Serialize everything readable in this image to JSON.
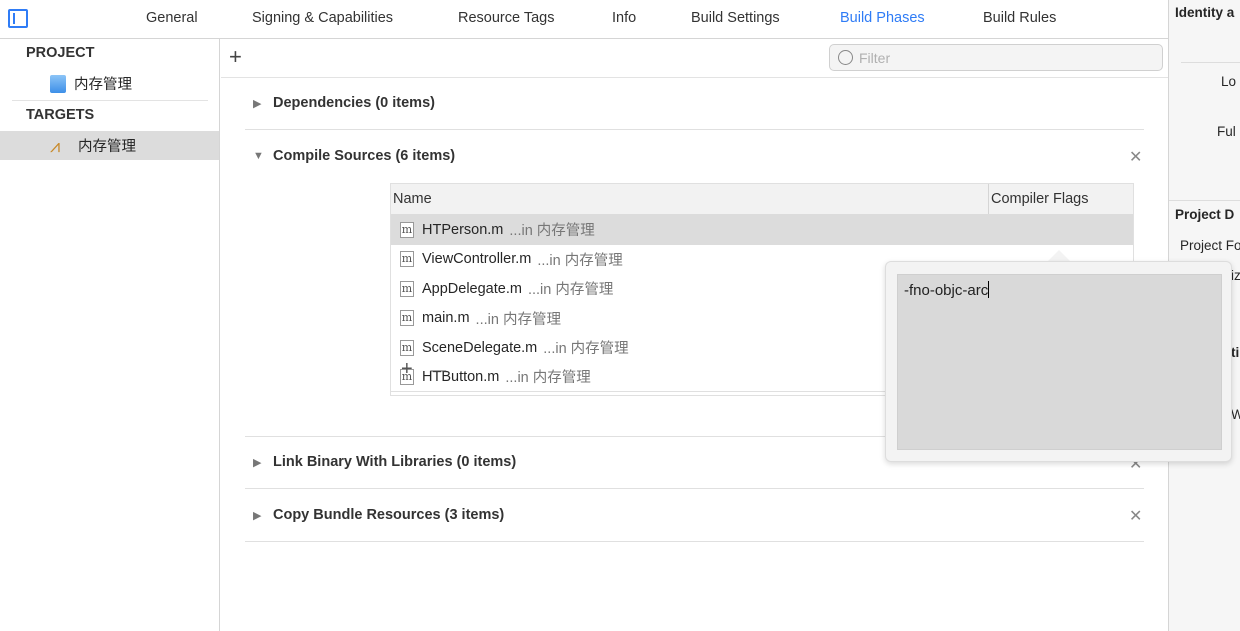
{
  "tabs": [
    {
      "label": "General",
      "active": false
    },
    {
      "label": "Signing & Capabilities",
      "active": false
    },
    {
      "label": "Resource Tags",
      "active": false
    },
    {
      "label": "Info",
      "active": false
    },
    {
      "label": "Build Settings",
      "active": false
    },
    {
      "label": "Build Phases",
      "active": true
    },
    {
      "label": "Build Rules",
      "active": false
    }
  ],
  "accent_color": "#2f7cf6",
  "sidebar": {
    "project_header": "PROJECT",
    "project_item": "内存管理",
    "targets_header": "TARGETS",
    "target_item": "内存管理"
  },
  "toolbar": {
    "add_label": "+",
    "filter_placeholder": "Filter"
  },
  "phases": {
    "dependencies": "Dependencies (0 items)",
    "compile": "Compile Sources (6 items)",
    "link": "Link Binary With Libraries (0 items)",
    "copy": "Copy Bundle Resources (3 items)"
  },
  "compile_table": {
    "col_name": "Name",
    "col_flags": "Compiler Flags",
    "rows": [
      {
        "file": "HTPerson.m",
        "location": "...in 内存管理"
      },
      {
        "file": "ViewController.m",
        "location": "...in 内存管理"
      },
      {
        "file": "AppDelegate.m",
        "location": "...in 内存管理"
      },
      {
        "file": "main.m",
        "location": "...in 内存管理"
      },
      {
        "file": "SceneDelegate.m",
        "location": "...in 内存管理"
      },
      {
        "file": "HTButton.m",
        "location": "...in 内存管理"
      }
    ],
    "add": "+",
    "remove": "—"
  },
  "flags_popover": {
    "value": "-fno-objc-arc"
  },
  "inspector": {
    "identity": "Identity a",
    "loc": "Lo",
    "full": "Ful",
    "project_doc": "Project D",
    "project_format": "Project Fo",
    "t1": "iz",
    "t2": "ti",
    "t3": "W"
  }
}
